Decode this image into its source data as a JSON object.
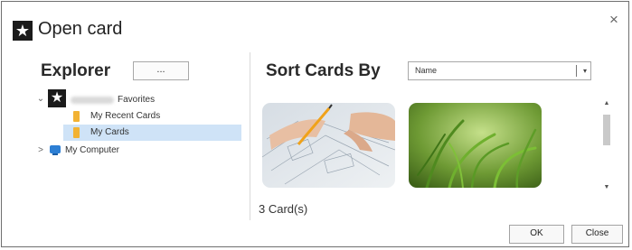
{
  "window": {
    "title": "Open card",
    "close_glyph": "×",
    "app_icon": "star-icon",
    "app_icon_glyph": "★"
  },
  "explorer": {
    "label": "Explorer",
    "browse_label": "...",
    "tree": {
      "favorites": {
        "label": "Favorites",
        "expand_glyph": "⌄",
        "star_glyph": "★"
      },
      "recent_cards": {
        "label": "My Recent Cards"
      },
      "my_cards": {
        "label": "My Cards",
        "selected": true
      },
      "my_computer": {
        "label": "My Computer",
        "expand_glyph": ">"
      }
    }
  },
  "sort": {
    "label": "Sort Cards By",
    "selected_value": "Name",
    "arrow_glyph": "▾"
  },
  "cards": [
    {
      "name": "blueprint-card"
    },
    {
      "name": "grass-card"
    }
  ],
  "scroll": {
    "up_glyph": "▲",
    "down_glyph": "▼"
  },
  "count_text": "3 Card(s)",
  "buttons": {
    "ok_label": "OK",
    "close_label": "Close"
  },
  "colors": {
    "selection": "#cfe3f7",
    "folder": "#f2b233",
    "computer": "#2d7fd4"
  }
}
